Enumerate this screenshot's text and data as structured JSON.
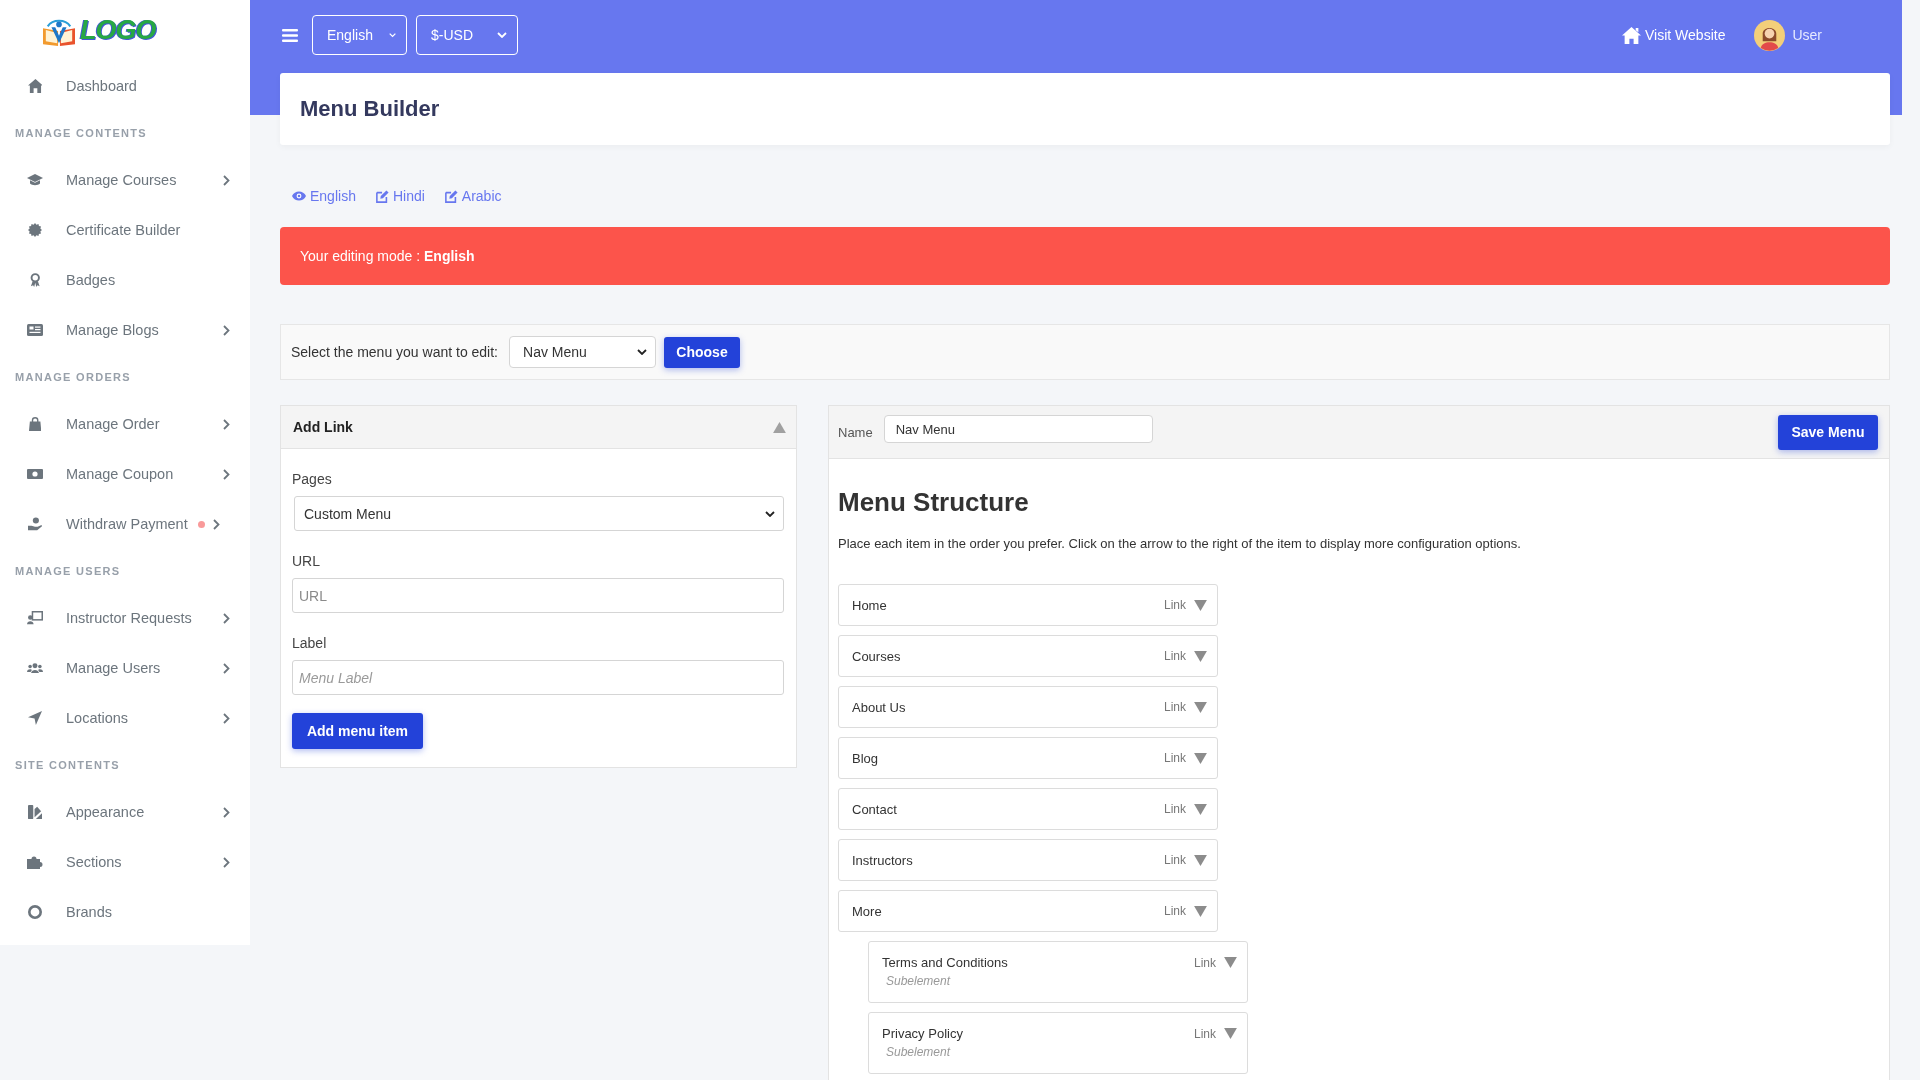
{
  "sidebar": {
    "logo": "LOGO",
    "groups": [
      {
        "items": [
          {
            "label": "Dashboard",
            "has_submenu": false,
            "notification": false
          }
        ]
      },
      {
        "title": "MANAGE CONTENTS",
        "items": [
          {
            "label": "Manage Courses",
            "has_submenu": true,
            "notification": false
          },
          {
            "label": "Certificate Builder",
            "has_submenu": false,
            "notification": false
          },
          {
            "label": "Badges",
            "has_submenu": false,
            "notification": false
          },
          {
            "label": "Manage Blogs",
            "has_submenu": true,
            "notification": false
          }
        ]
      },
      {
        "title": "MANAGE ORDERS",
        "items": [
          {
            "label": "Manage Order",
            "has_submenu": true,
            "notification": false
          },
          {
            "label": "Manage Coupon",
            "has_submenu": true,
            "notification": false
          },
          {
            "label": "Withdraw Payment",
            "has_submenu": true,
            "notification": true
          }
        ]
      },
      {
        "title": "MANAGE USERS",
        "items": [
          {
            "label": "Instructor Requests",
            "has_submenu": true,
            "notification": false
          },
          {
            "label": "Manage Users",
            "has_submenu": true,
            "notification": false
          },
          {
            "label": "Locations",
            "has_submenu": true,
            "notification": false
          }
        ]
      },
      {
        "title": "SITE CONTENTS",
        "items": [
          {
            "label": "Appearance",
            "has_submenu": true,
            "notification": false
          },
          {
            "label": "Sections",
            "has_submenu": true,
            "notification": false
          },
          {
            "label": "Brands",
            "has_submenu": false,
            "notification": false
          }
        ]
      }
    ]
  },
  "topbar": {
    "language": "English",
    "currency": "$-USD",
    "visit_link": "Visit Website",
    "user": "User"
  },
  "page": {
    "title": "Menu Builder"
  },
  "languages": [
    {
      "label": "English",
      "selected": true
    },
    {
      "label": "Hindi",
      "selected": false
    },
    {
      "label": "Arabic",
      "selected": false
    }
  ],
  "alert": {
    "text": "Your editing mode : **English**"
  },
  "menu_select": {
    "label": "Select the menu you want to edit:",
    "value": "Nav Menu",
    "button": "Choose"
  },
  "add_link": {
    "title": "Add Link",
    "expanded": true,
    "fields": [
      {
        "kind": "select",
        "label": "Pages",
        "value": "Custom Menu"
      },
      {
        "kind": "url",
        "label": "URL",
        "placeholder": "URL"
      },
      {
        "kind": "text",
        "label": "Label",
        "placeholder": "Menu Label"
      }
    ],
    "button": "Add menu item"
  },
  "structure": {
    "name_label": "Name",
    "name_value": "Nav Menu",
    "save_button": "Save Menu",
    "title": "Menu Structure",
    "description": "Place each item in the order you prefer. Click on the arrow to the right of the item to display more configuration options.",
    "items": [
      {
        "title": "Home",
        "type": "Link",
        "expanded": false
      },
      {
        "title": "Courses",
        "type": "Link",
        "expanded": false
      },
      {
        "title": "About Us",
        "type": "Link",
        "expanded": false
      },
      {
        "title": "Blog",
        "type": "Link",
        "expanded": false
      },
      {
        "title": "Contact",
        "type": "Link",
        "expanded": false
      },
      {
        "title": "Instructors",
        "type": "Link",
        "expanded": false
      },
      {
        "title": "More",
        "type": "Link",
        "expanded": false,
        "children": [
          {
            "title": "Terms and Conditions",
            "type": "Link",
            "note": "Subelement",
            "expanded": false
          },
          {
            "title": "Privacy Policy",
            "type": "Link",
            "note": "Subelement",
            "expanded": false
          }
        ]
      }
    ]
  }
}
